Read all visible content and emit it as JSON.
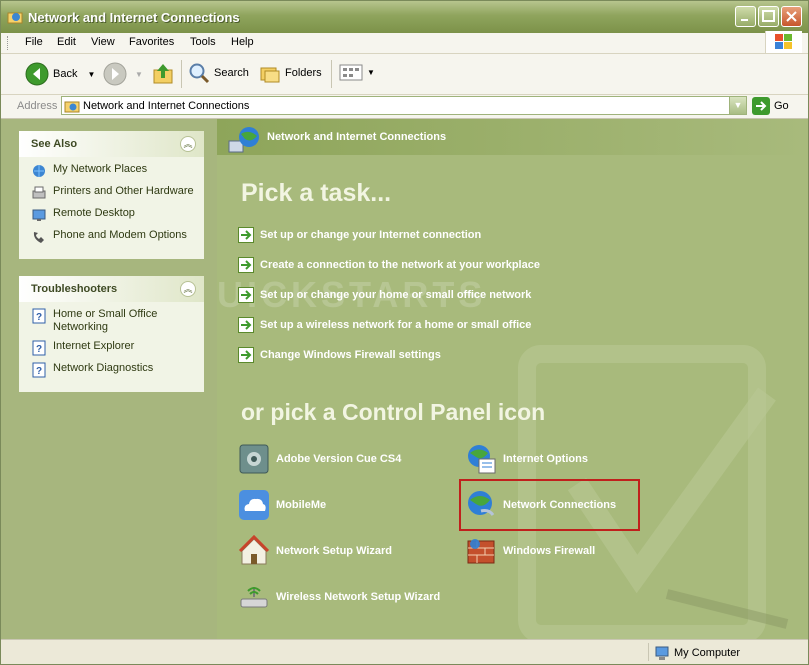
{
  "window": {
    "title": "Network and Internet Connections"
  },
  "menu": [
    "File",
    "Edit",
    "View",
    "Favorites",
    "Tools",
    "Help"
  ],
  "toolbar": {
    "back": "Back",
    "search": "Search",
    "folders": "Folders"
  },
  "address": {
    "label": "Address",
    "value": "Network and Internet Connections",
    "go": "Go"
  },
  "see_also": {
    "title": "See Also",
    "items": [
      "My Network Places",
      "Printers and Other Hardware",
      "Remote Desktop",
      "Phone and Modem Options"
    ]
  },
  "troubleshooters": {
    "title": "Troubleshooters",
    "items": [
      "Home or Small Office Networking",
      "Internet Explorer",
      "Network Diagnostics"
    ]
  },
  "main": {
    "header": "Network and Internet Connections",
    "pick_task": "Pick a task...",
    "tasks": [
      "Set up or change your Internet connection",
      "Create a connection to the network at your workplace",
      "Set up or change your home or small office network",
      "Set up a wireless network for a home or small office",
      "Change Windows Firewall settings"
    ],
    "or_pick": "or pick a Control Panel icon",
    "icons": [
      "Adobe Version Cue CS4",
      "Internet Options",
      "MobileMe",
      "Network Connections",
      "Network Setup Wizard",
      "Windows Firewall",
      "Wireless Network Setup Wizard"
    ],
    "watermark": "QUICKSTARTS"
  },
  "status": {
    "zone": "My Computer"
  },
  "colors": {
    "titlebar": "#8fa45d",
    "pane": "#a8ba7c",
    "highlight": "#c0201c"
  }
}
